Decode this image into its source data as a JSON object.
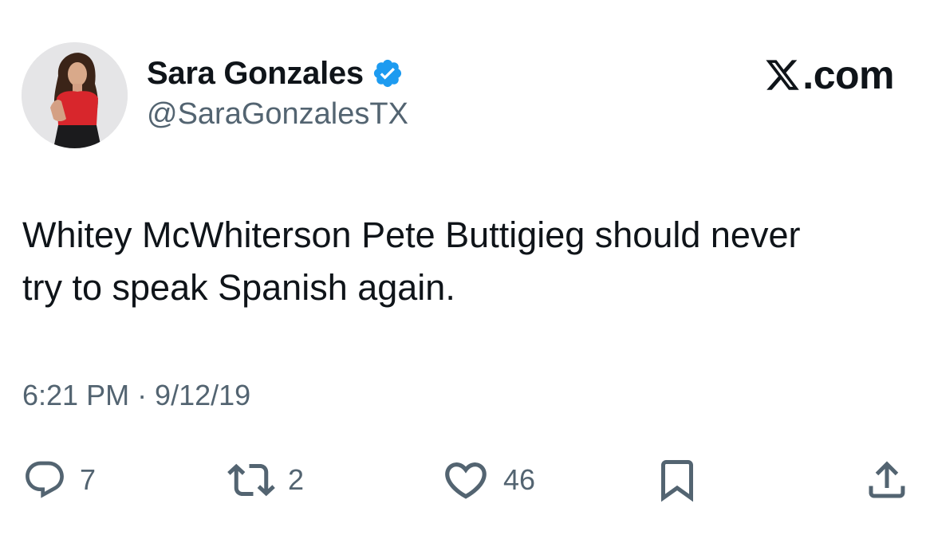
{
  "author": {
    "display_name": "Sara Gonzales",
    "handle": "@SaraGonzalesTX",
    "verified": true
  },
  "brand": {
    "text": ".com",
    "icon": "x-logo-icon"
  },
  "tweet": {
    "lines": [
      "Whitey McWhiterson Pete Buttigieg should never",
      "try to speak Spanish again."
    ],
    "timestamp": "6:21 PM · 9/12/19"
  },
  "actions": {
    "replies": "7",
    "retweets": "2",
    "likes": "46"
  },
  "colors": {
    "text": "#0f1419",
    "secondary": "#536471",
    "verified": "#1d9bf0",
    "background": "#ffffff"
  }
}
